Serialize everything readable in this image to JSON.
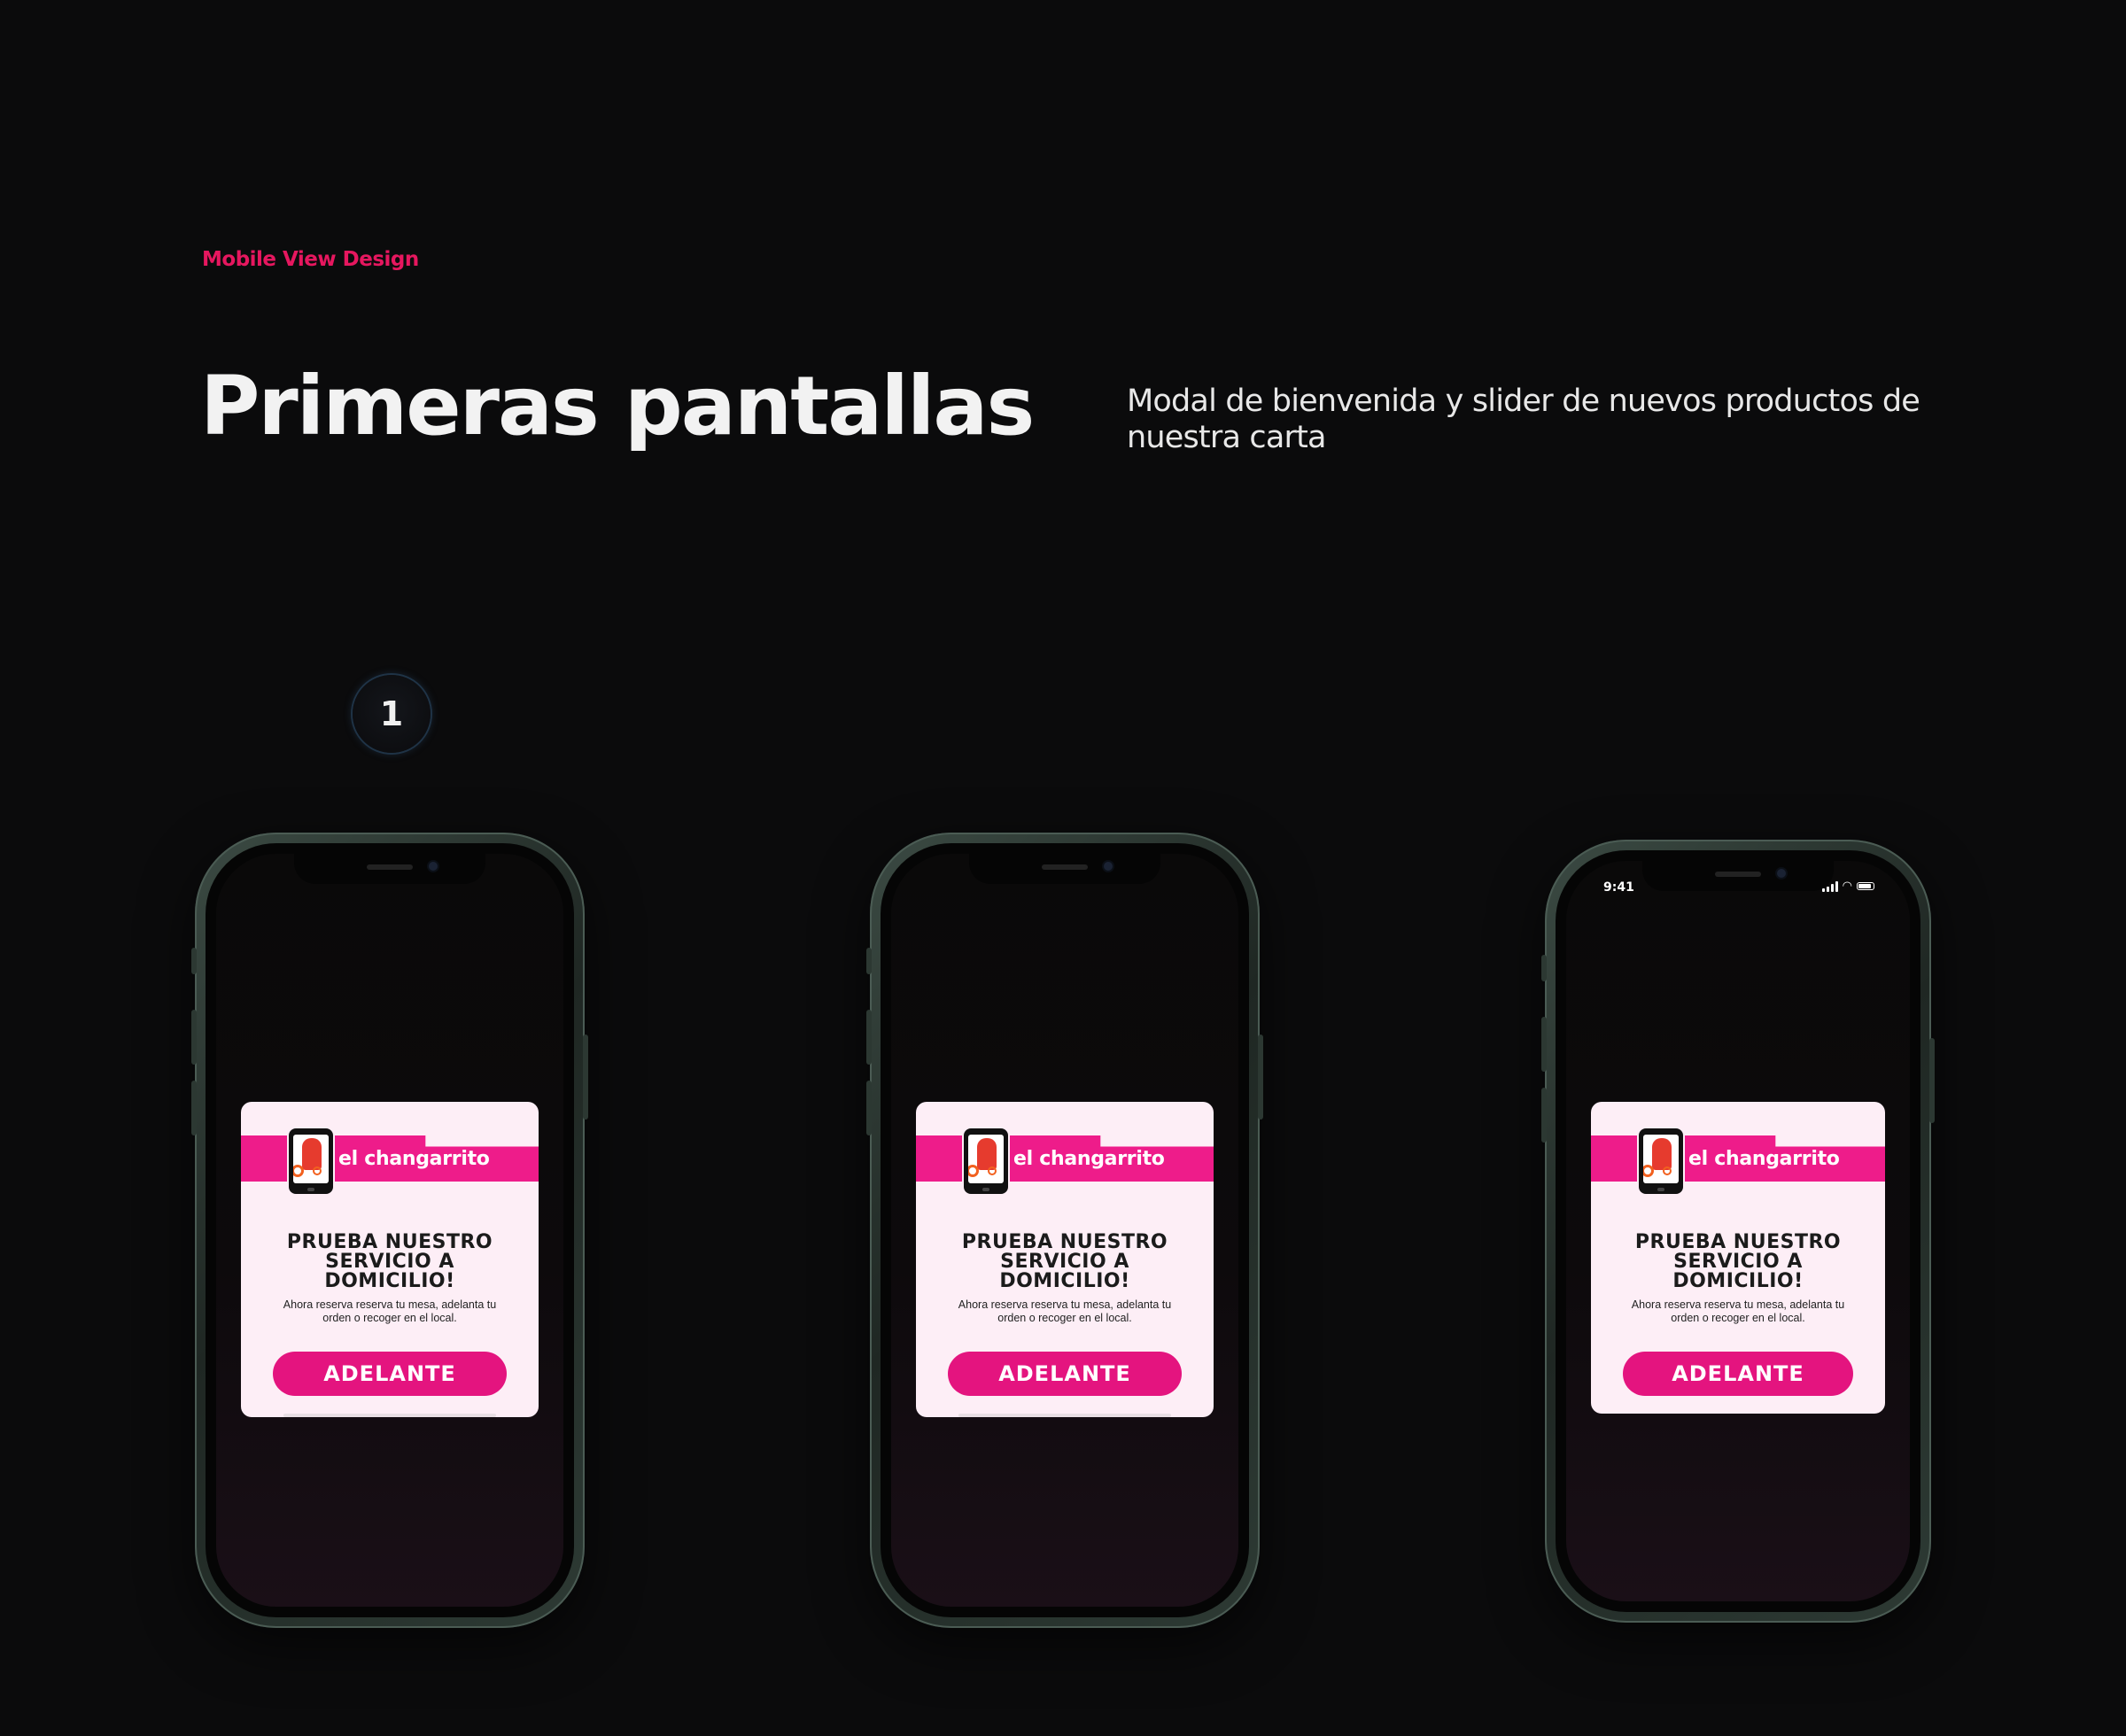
{
  "header": {
    "eyebrow": "Mobile View Design",
    "title": "Primeras pantallas",
    "subtitle": "Modal de bienvenida y slider de nuevos productos de nuestra carta"
  },
  "step": {
    "number": "1"
  },
  "status_bar": {
    "time": "9:41"
  },
  "modal": {
    "brand": "el changarrito",
    "headline_lines": [
      "PRUEBA NUESTRO",
      "SERVICIO A",
      "DOMICILIO!"
    ],
    "body_lines": [
      "Ahora reserva reserva tu mesa, adelanta tu",
      "orden o recoger en el local."
    ],
    "cta_label": "ADELANTE"
  },
  "colors": {
    "accent": "#e4147f",
    "eyebrow": "#e6175f",
    "modal_bg": "#fdeef6",
    "phone_frame": "#2a3530"
  }
}
